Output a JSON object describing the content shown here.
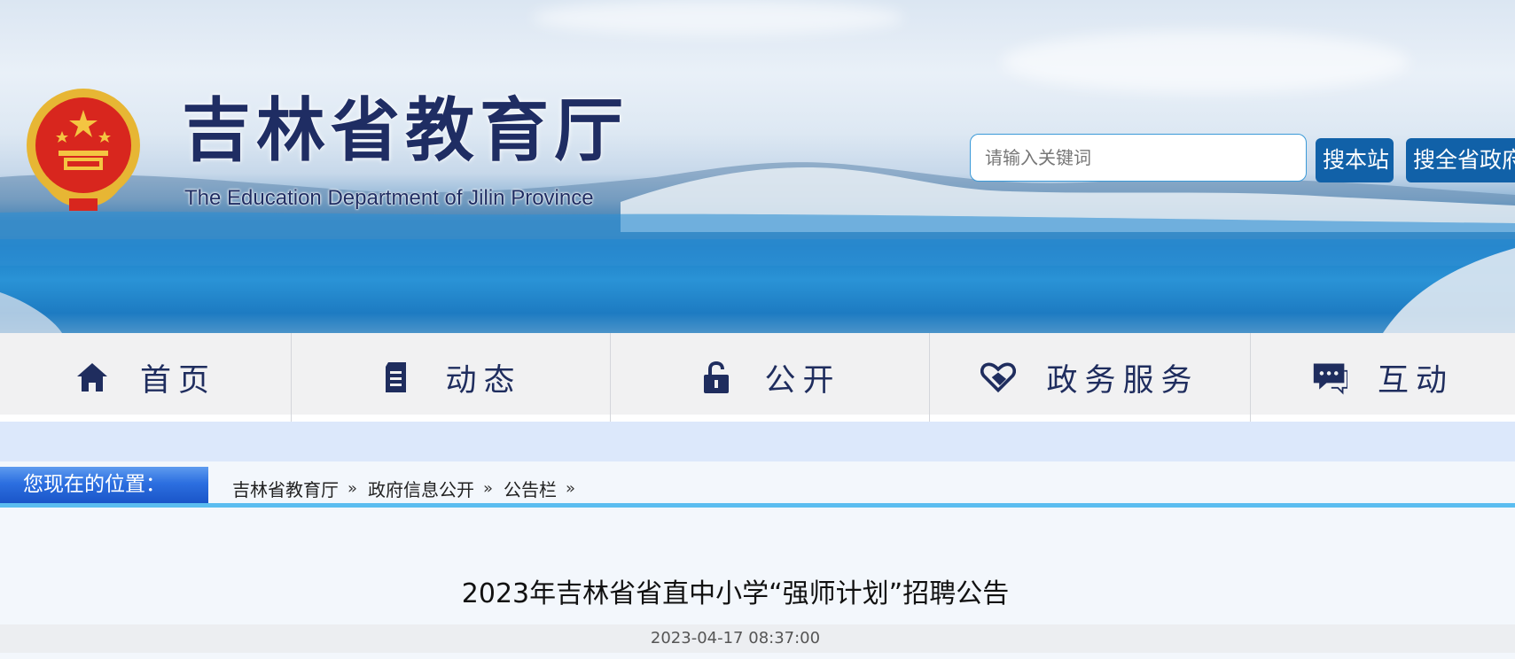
{
  "header": {
    "site_title": "吉林省教育厅",
    "site_subtitle": "The Education Department of Jilin Province",
    "search": {
      "placeholder": "请输入关键词",
      "button_site": "搜本站",
      "button_gov": "搜全省政府"
    }
  },
  "nav": {
    "items": [
      {
        "label": "首页",
        "icon": "home-icon"
      },
      {
        "label": "动态",
        "icon": "document-icon"
      },
      {
        "label": "公开",
        "icon": "lock-icon"
      },
      {
        "label": "政务服务",
        "icon": "handshake-icon"
      },
      {
        "label": "互动",
        "icon": "chat-icon"
      }
    ]
  },
  "breadcrumb": {
    "tag": "您现在的位置：",
    "items": [
      "吉林省教育厅",
      "政府信息公开",
      "公告栏"
    ],
    "separator": "»"
  },
  "article": {
    "title": "2023年吉林省省直中小学“强师计划”招聘公告",
    "date": "2023-04-17 08:37:00"
  },
  "colors": {
    "title_navy": "#1f2d63",
    "button_blue": "#1161a8",
    "breadcrumb_blue": "#2c6fe0",
    "accent_line": "#5bbdf0"
  }
}
